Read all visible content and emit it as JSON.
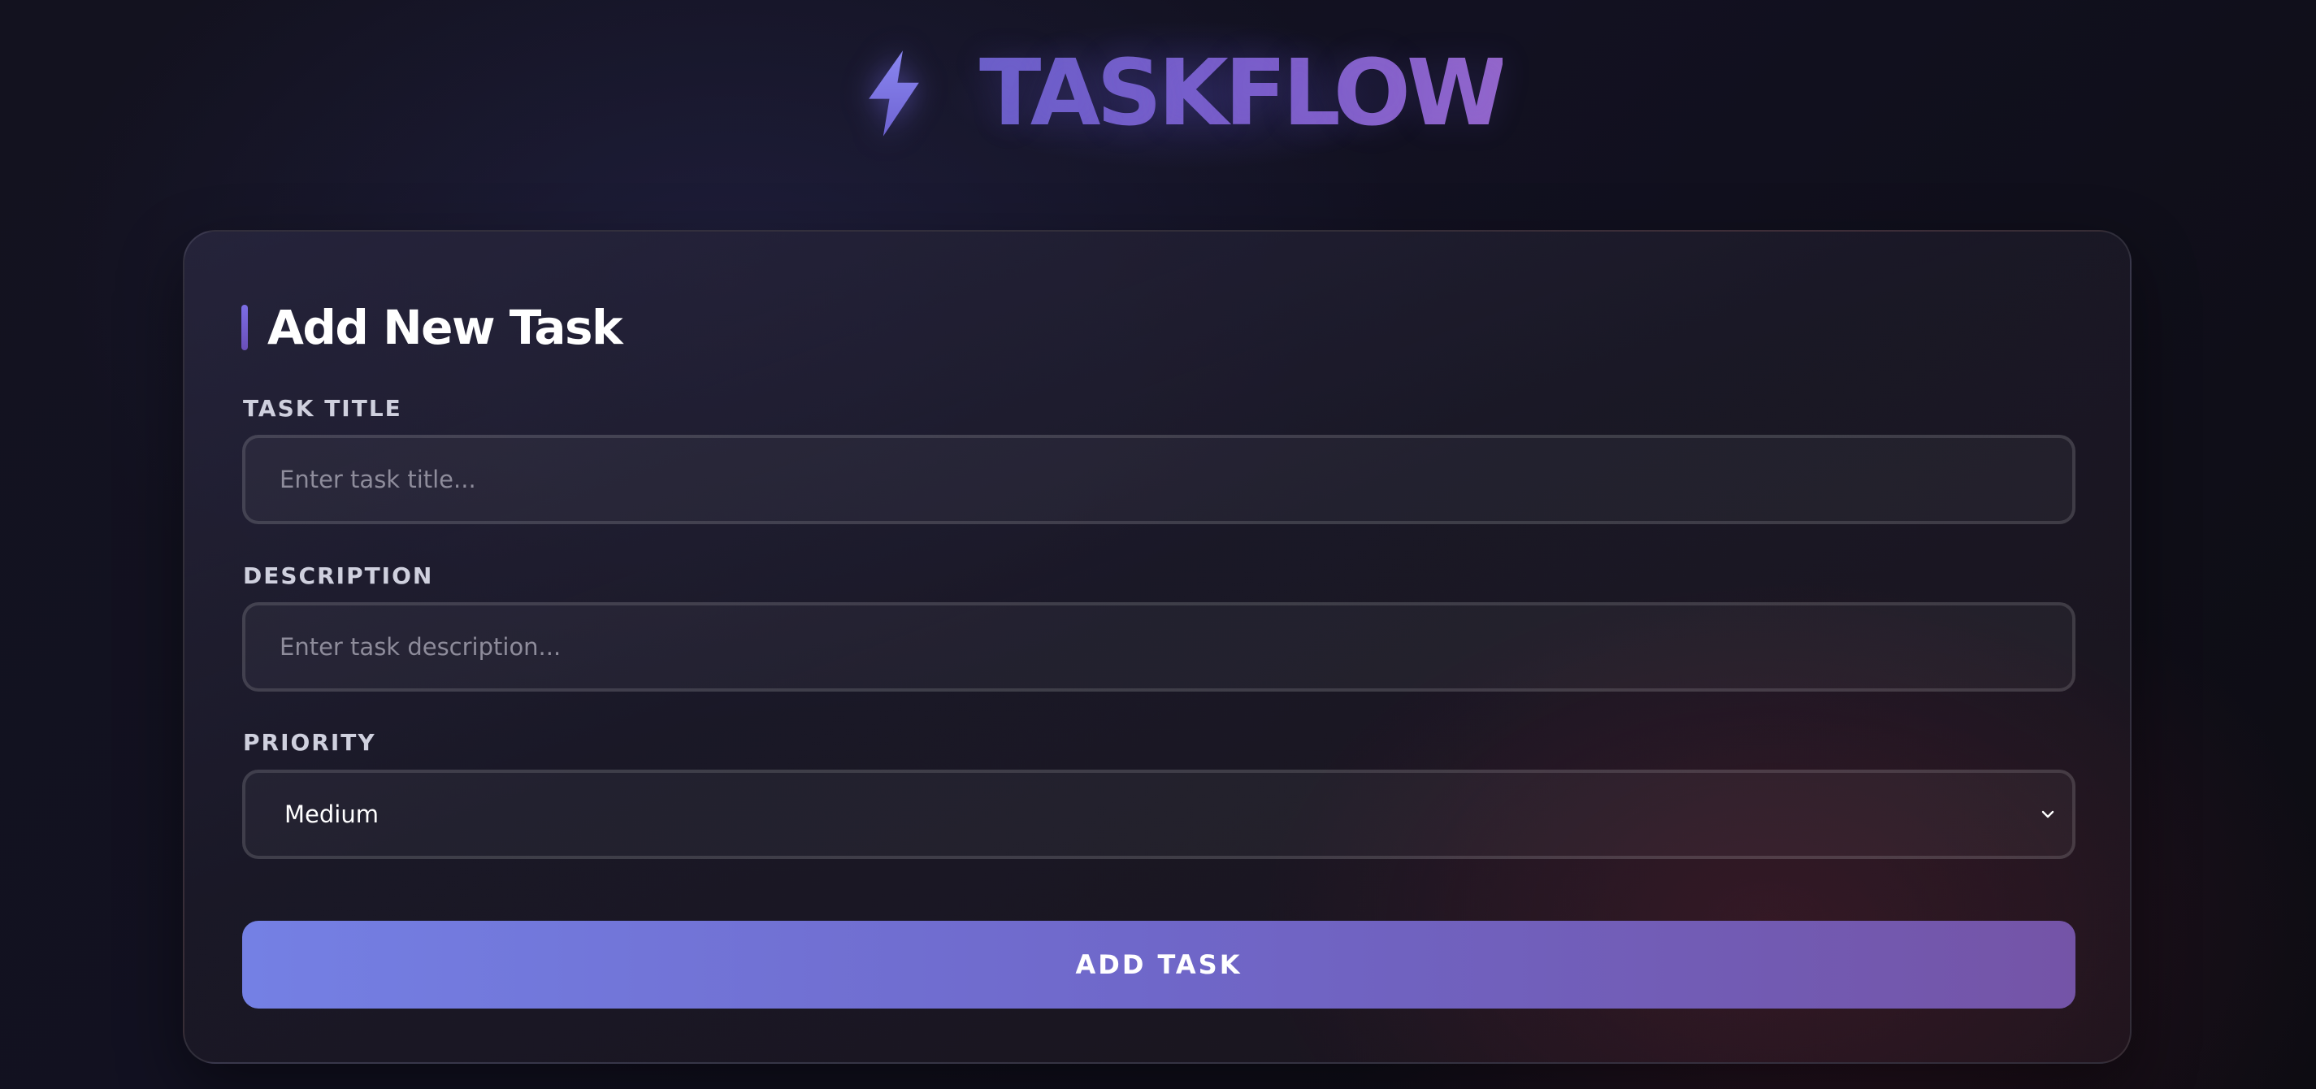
{
  "brand": {
    "icon": "lightning-bolt-icon",
    "name": "TASKFLOW"
  },
  "form": {
    "heading": "Add New Task",
    "title_field": {
      "label": "TASK TITLE",
      "value": "",
      "placeholder": "Enter task title..."
    },
    "description_field": {
      "label": "DESCRIPTION",
      "value": "",
      "placeholder": "Enter task description..."
    },
    "priority_field": {
      "label": "PRIORITY",
      "selected": "Medium",
      "icon": "chevron-down-icon"
    },
    "submit_label": "ADD TASK"
  },
  "colors": {
    "accent_start": "#7480e4",
    "accent_end": "#7454a7",
    "brand_text": "#7b5ec8",
    "background": "#13121f"
  }
}
